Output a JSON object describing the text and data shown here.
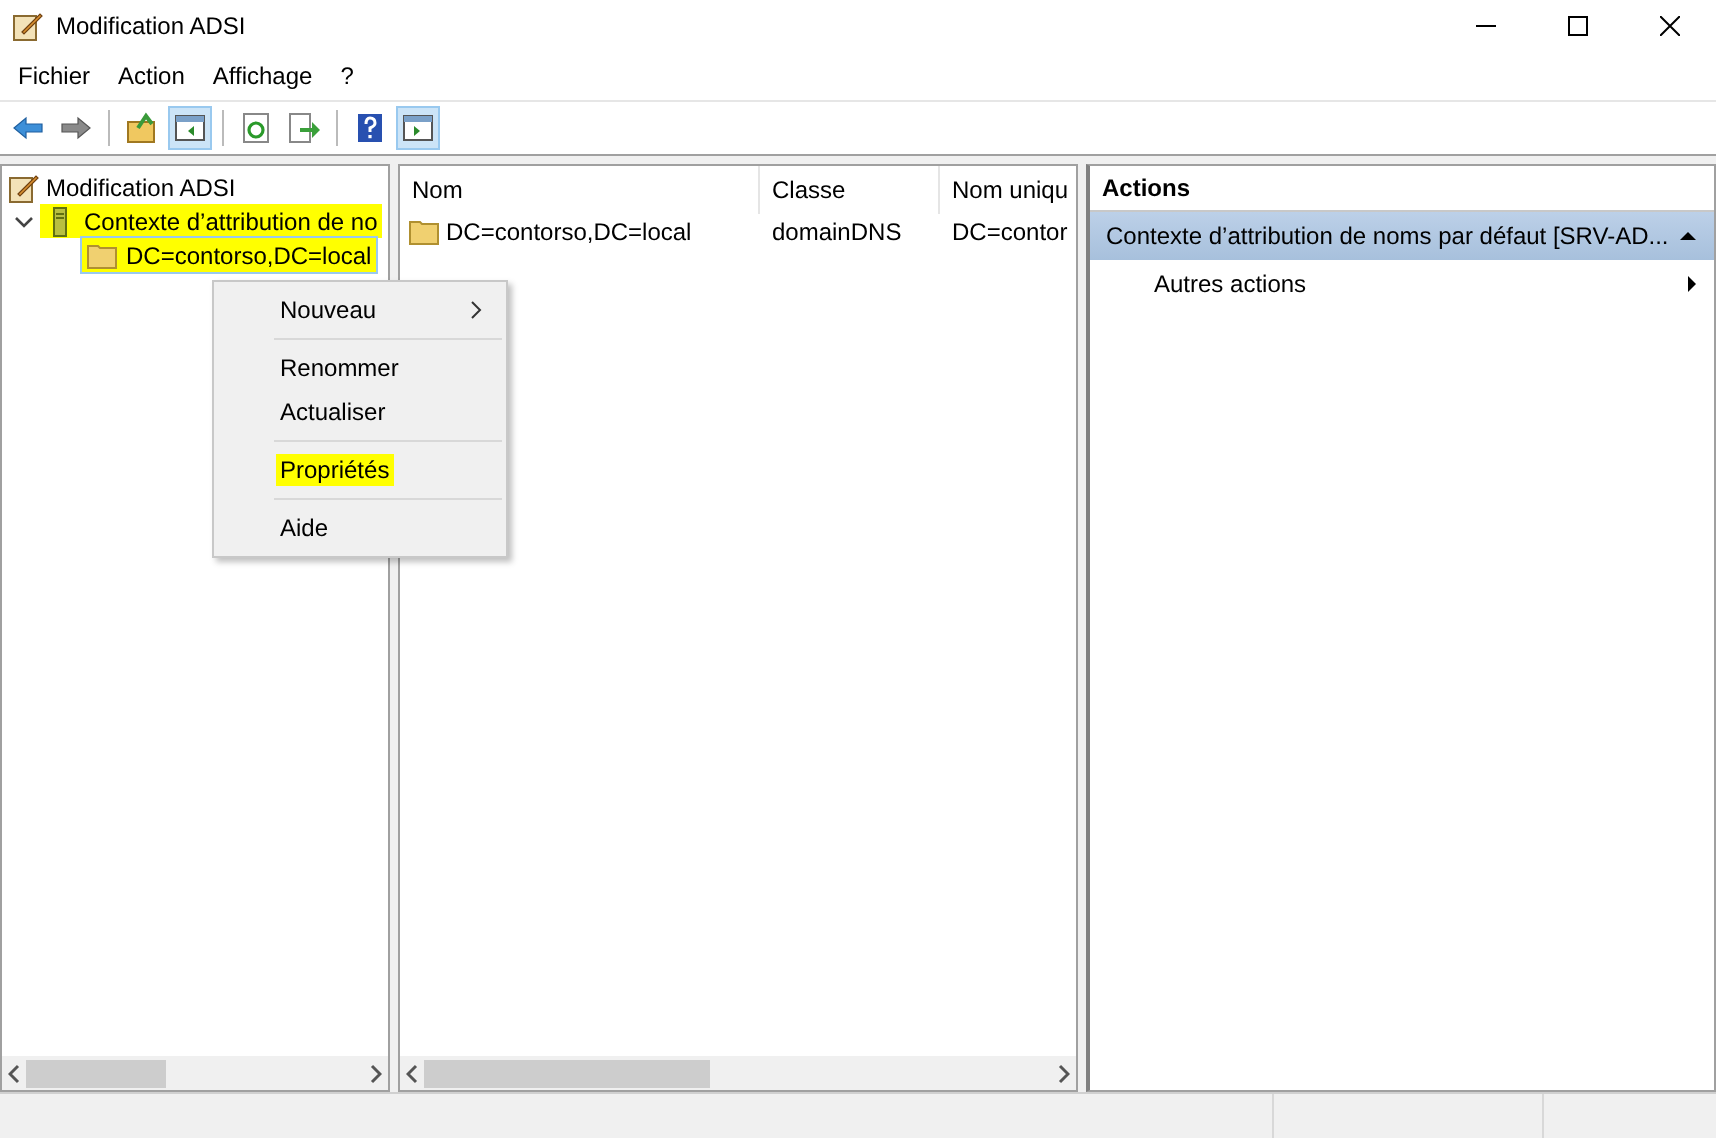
{
  "window": {
    "title": "Modification ADSI"
  },
  "menu": [
    "Fichier",
    "Action",
    "Affichage",
    "?"
  ],
  "toolbar": [
    {
      "kind": "back",
      "pressed": false
    },
    {
      "kind": "forward",
      "pressed": false
    },
    {
      "kind": "sep"
    },
    {
      "kind": "up",
      "pressed": false
    },
    {
      "kind": "tree",
      "pressed": true
    },
    {
      "kind": "sep"
    },
    {
      "kind": "refresh",
      "pressed": false
    },
    {
      "kind": "export",
      "pressed": false
    },
    {
      "kind": "sep"
    },
    {
      "kind": "help",
      "pressed": false
    },
    {
      "kind": "actions",
      "pressed": true
    }
  ],
  "tree": {
    "label": "Modification ADSI",
    "children": [
      {
        "label": "Contexte d’attribution de no",
        "expanded": true,
        "highlighted": true,
        "selected": false,
        "kind": "server",
        "children": [
          {
            "label": "DC=contorso,DC=local",
            "highlighted": true,
            "selected": true,
            "kind": "folder"
          }
        ]
      }
    ]
  },
  "context_menu": [
    {
      "kind": "item",
      "label": "Nouveau",
      "submenu": true,
      "highlighted": false
    },
    {
      "kind": "sep"
    },
    {
      "kind": "item",
      "label": "Renommer",
      "submenu": false,
      "highlighted": false
    },
    {
      "kind": "item",
      "label": "Actualiser",
      "submenu": false,
      "highlighted": false
    },
    {
      "kind": "sep"
    },
    {
      "kind": "item",
      "label": "Propriétés",
      "submenu": false,
      "highlighted": true
    },
    {
      "kind": "sep"
    },
    {
      "kind": "item",
      "label": "Aide",
      "submenu": false,
      "highlighted": false
    }
  ],
  "table": {
    "columns": [
      "Nom",
      "Classe",
      "Nom uniqu"
    ],
    "rows": [
      [
        "DC=contorso,DC=local",
        "domainDNS",
        "DC=contor"
      ]
    ]
  },
  "actions": {
    "title": "Actions",
    "section": "Contexte d’attribution de noms par défaut [SRV-AD...",
    "expanded": true,
    "items": [
      {
        "label": "Autres actions",
        "submenu": true
      }
    ]
  }
}
